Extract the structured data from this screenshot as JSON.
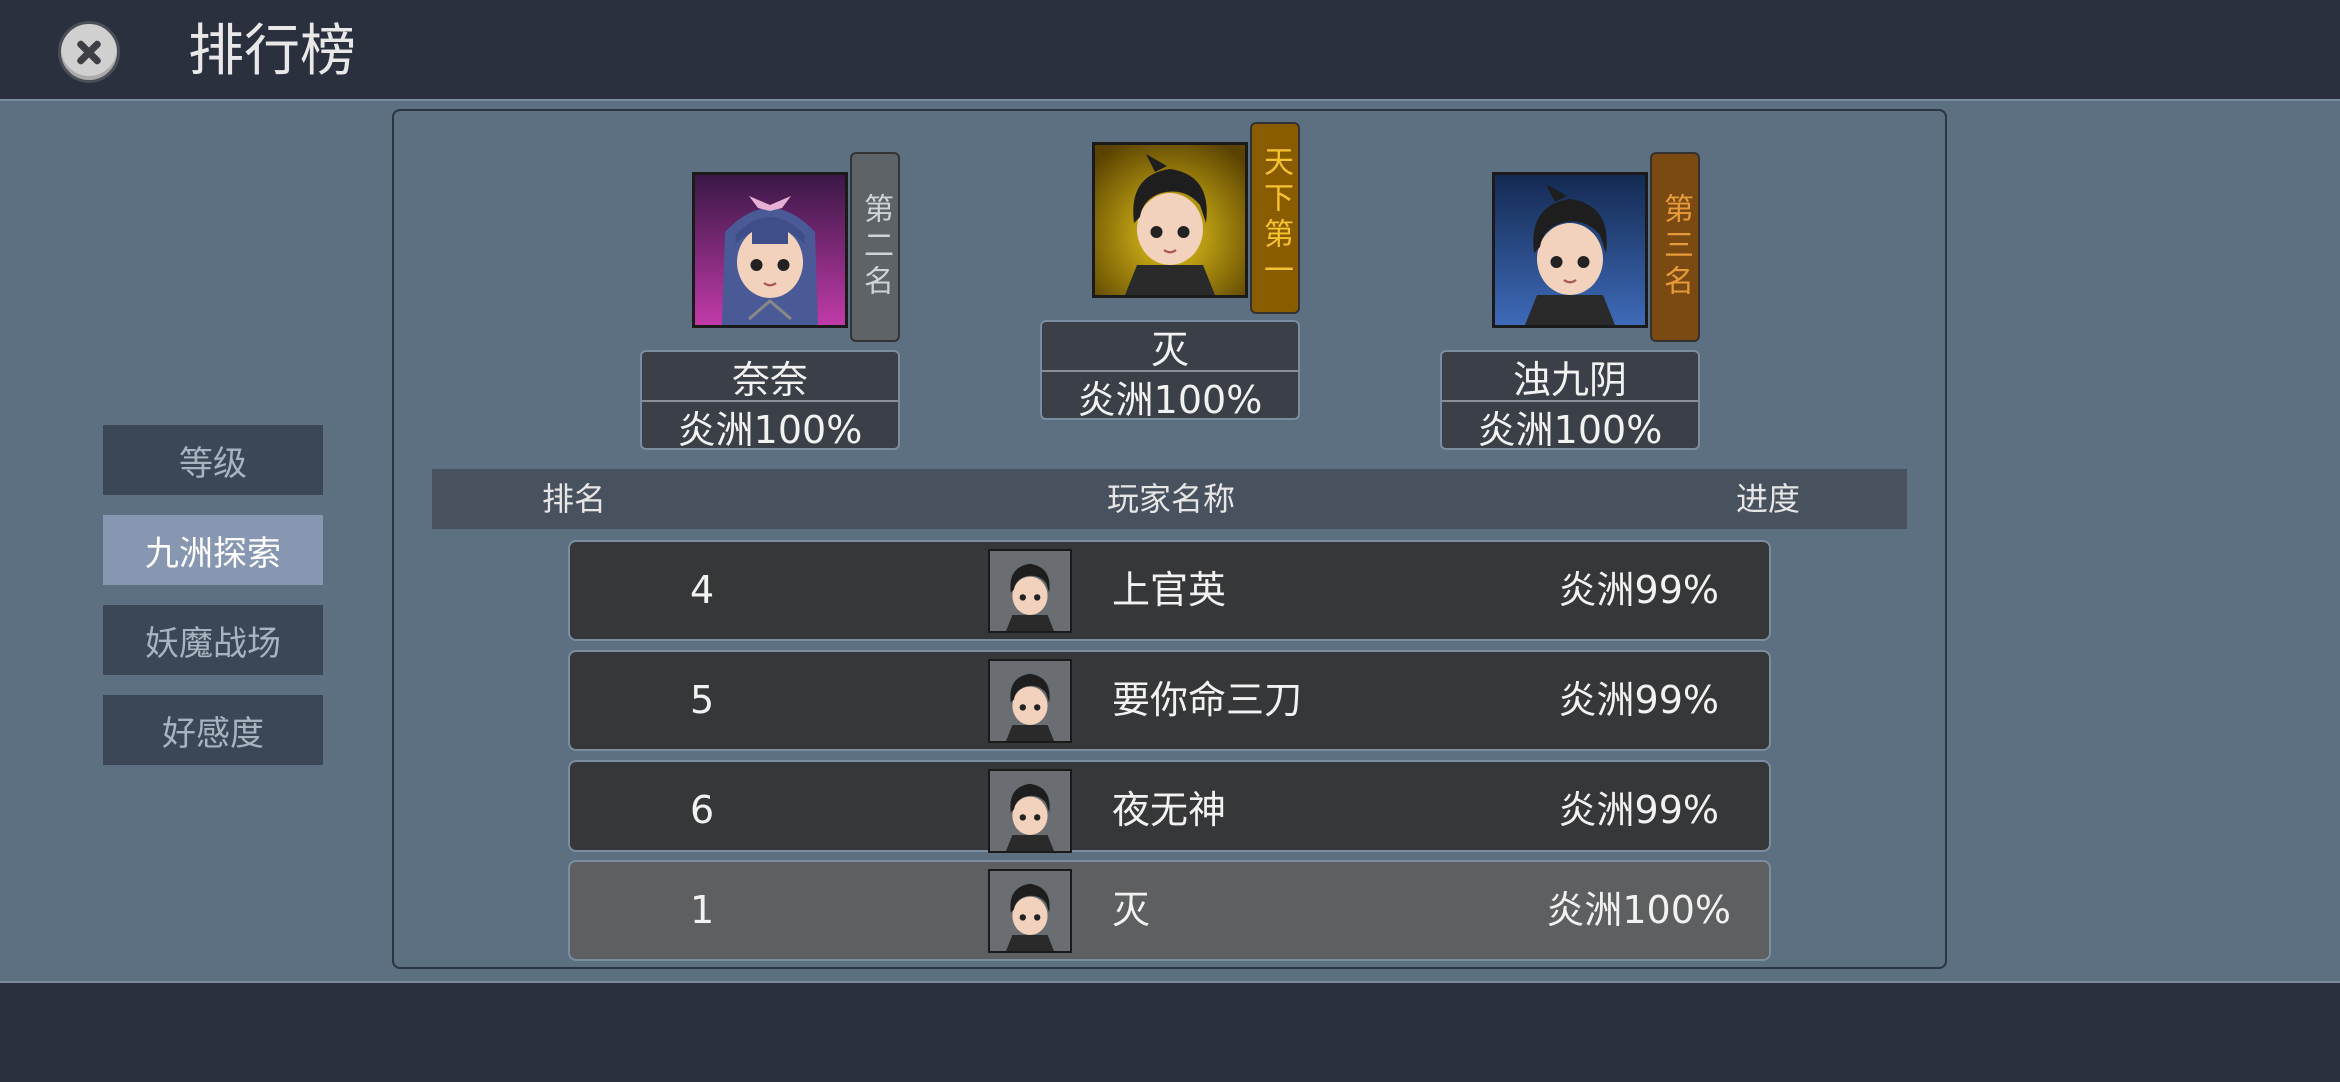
{
  "header": {
    "title": "排行榜",
    "close_icon": "close-icon"
  },
  "sidebar": {
    "tabs": [
      {
        "label": "等级",
        "active": false
      },
      {
        "label": "九洲探索",
        "active": true
      },
      {
        "label": "妖魔战场",
        "active": false
      },
      {
        "label": "好感度",
        "active": false
      }
    ]
  },
  "podium": {
    "first": {
      "tag": "天下第一",
      "name": "灭",
      "progress": "炎洲100%"
    },
    "second": {
      "tag": "第二名",
      "name": "奈奈",
      "progress": "炎洲100%"
    },
    "third": {
      "tag": "第三名",
      "name": "浊九阴",
      "progress": "炎洲100%"
    }
  },
  "table": {
    "headers": {
      "rank": "排名",
      "name": "玩家名称",
      "progress": "进度"
    },
    "rows": [
      {
        "rank": "4",
        "name": "上官英",
        "progress": "炎洲99%"
      },
      {
        "rank": "5",
        "name": "要你命三刀",
        "progress": "炎洲99%"
      },
      {
        "rank": "6",
        "name": "夜无神",
        "progress": "炎洲99%"
      }
    ],
    "self_row": {
      "rank": "1",
      "name": "灭",
      "progress": "炎洲100%"
    }
  },
  "colors": {
    "background": "#5d7082",
    "bar": "#2a303d",
    "tab_active": "#8797b2",
    "tab_inactive": "#3b4657",
    "gold_tag": "#8a5c00",
    "bronze_tag": "#7a4a12",
    "silver_tag": "#5e6368"
  }
}
